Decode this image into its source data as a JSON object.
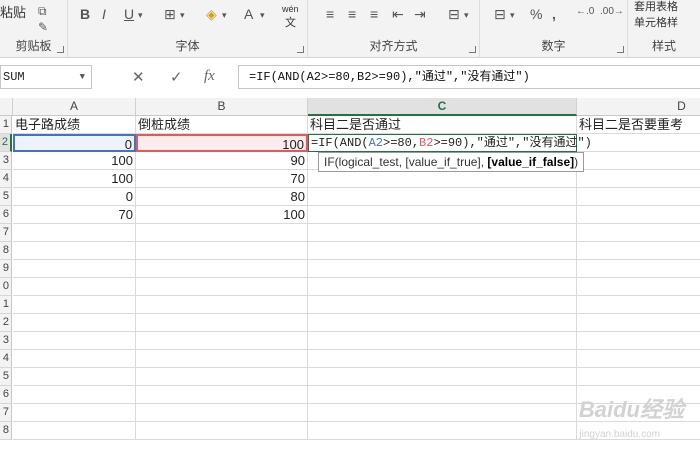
{
  "ribbon": {
    "clipboard": {
      "paste_label": "粘贴",
      "group_label": "剪贴板"
    },
    "font": {
      "group_label": "字体",
      "bold": "B",
      "italic": "I",
      "underline": "U",
      "font_color": "A",
      "wen": "wén",
      "wen_sub": "文"
    },
    "alignment": {
      "group_label": "对齐方式"
    },
    "number": {
      "group_label": "数字",
      "percent": "%",
      "comma": ","
    },
    "styles": {
      "group_label": "样式",
      "table_format": "套用表格",
      "cell_style": "单元格样"
    }
  },
  "formula_bar": {
    "name_box": "SUM",
    "formula": "=IF(AND(A2>=80,B2>=90),\"通过\",\"没有通过\")"
  },
  "columns": [
    "A",
    "B",
    "C",
    "D"
  ],
  "rows": [
    "1",
    "2",
    "3",
    "4",
    "5",
    "6",
    "7",
    "8",
    "9",
    "0",
    "1",
    "2",
    "3",
    "4",
    "5",
    "6",
    "7",
    "8"
  ],
  "cells": {
    "A1": "电子路成绩",
    "B1": "倒桩成绩",
    "C1": "科目二是否通过",
    "D1": "科目二是否要重考",
    "A2": "0",
    "B2": "100",
    "A3": "100",
    "B3": "90",
    "A4": "100",
    "B4": "70",
    "A5": "0",
    "B5": "80",
    "A6": "70",
    "B6": "100"
  },
  "editing": {
    "prefix": "=IF(AND(",
    "ref_a": "A2",
    "mid": ">=80,",
    "ref_b": "B2",
    "suffix": ">=90),\"通过\",\"没有通过\")"
  },
  "tooltip": {
    "fn": "IF(logical_test, [value_if_true], ",
    "bold": "[value_if_false]",
    "close": ")"
  },
  "watermark": {
    "main": "Baidu经验",
    "sub": "jingyan.baidu.com"
  }
}
